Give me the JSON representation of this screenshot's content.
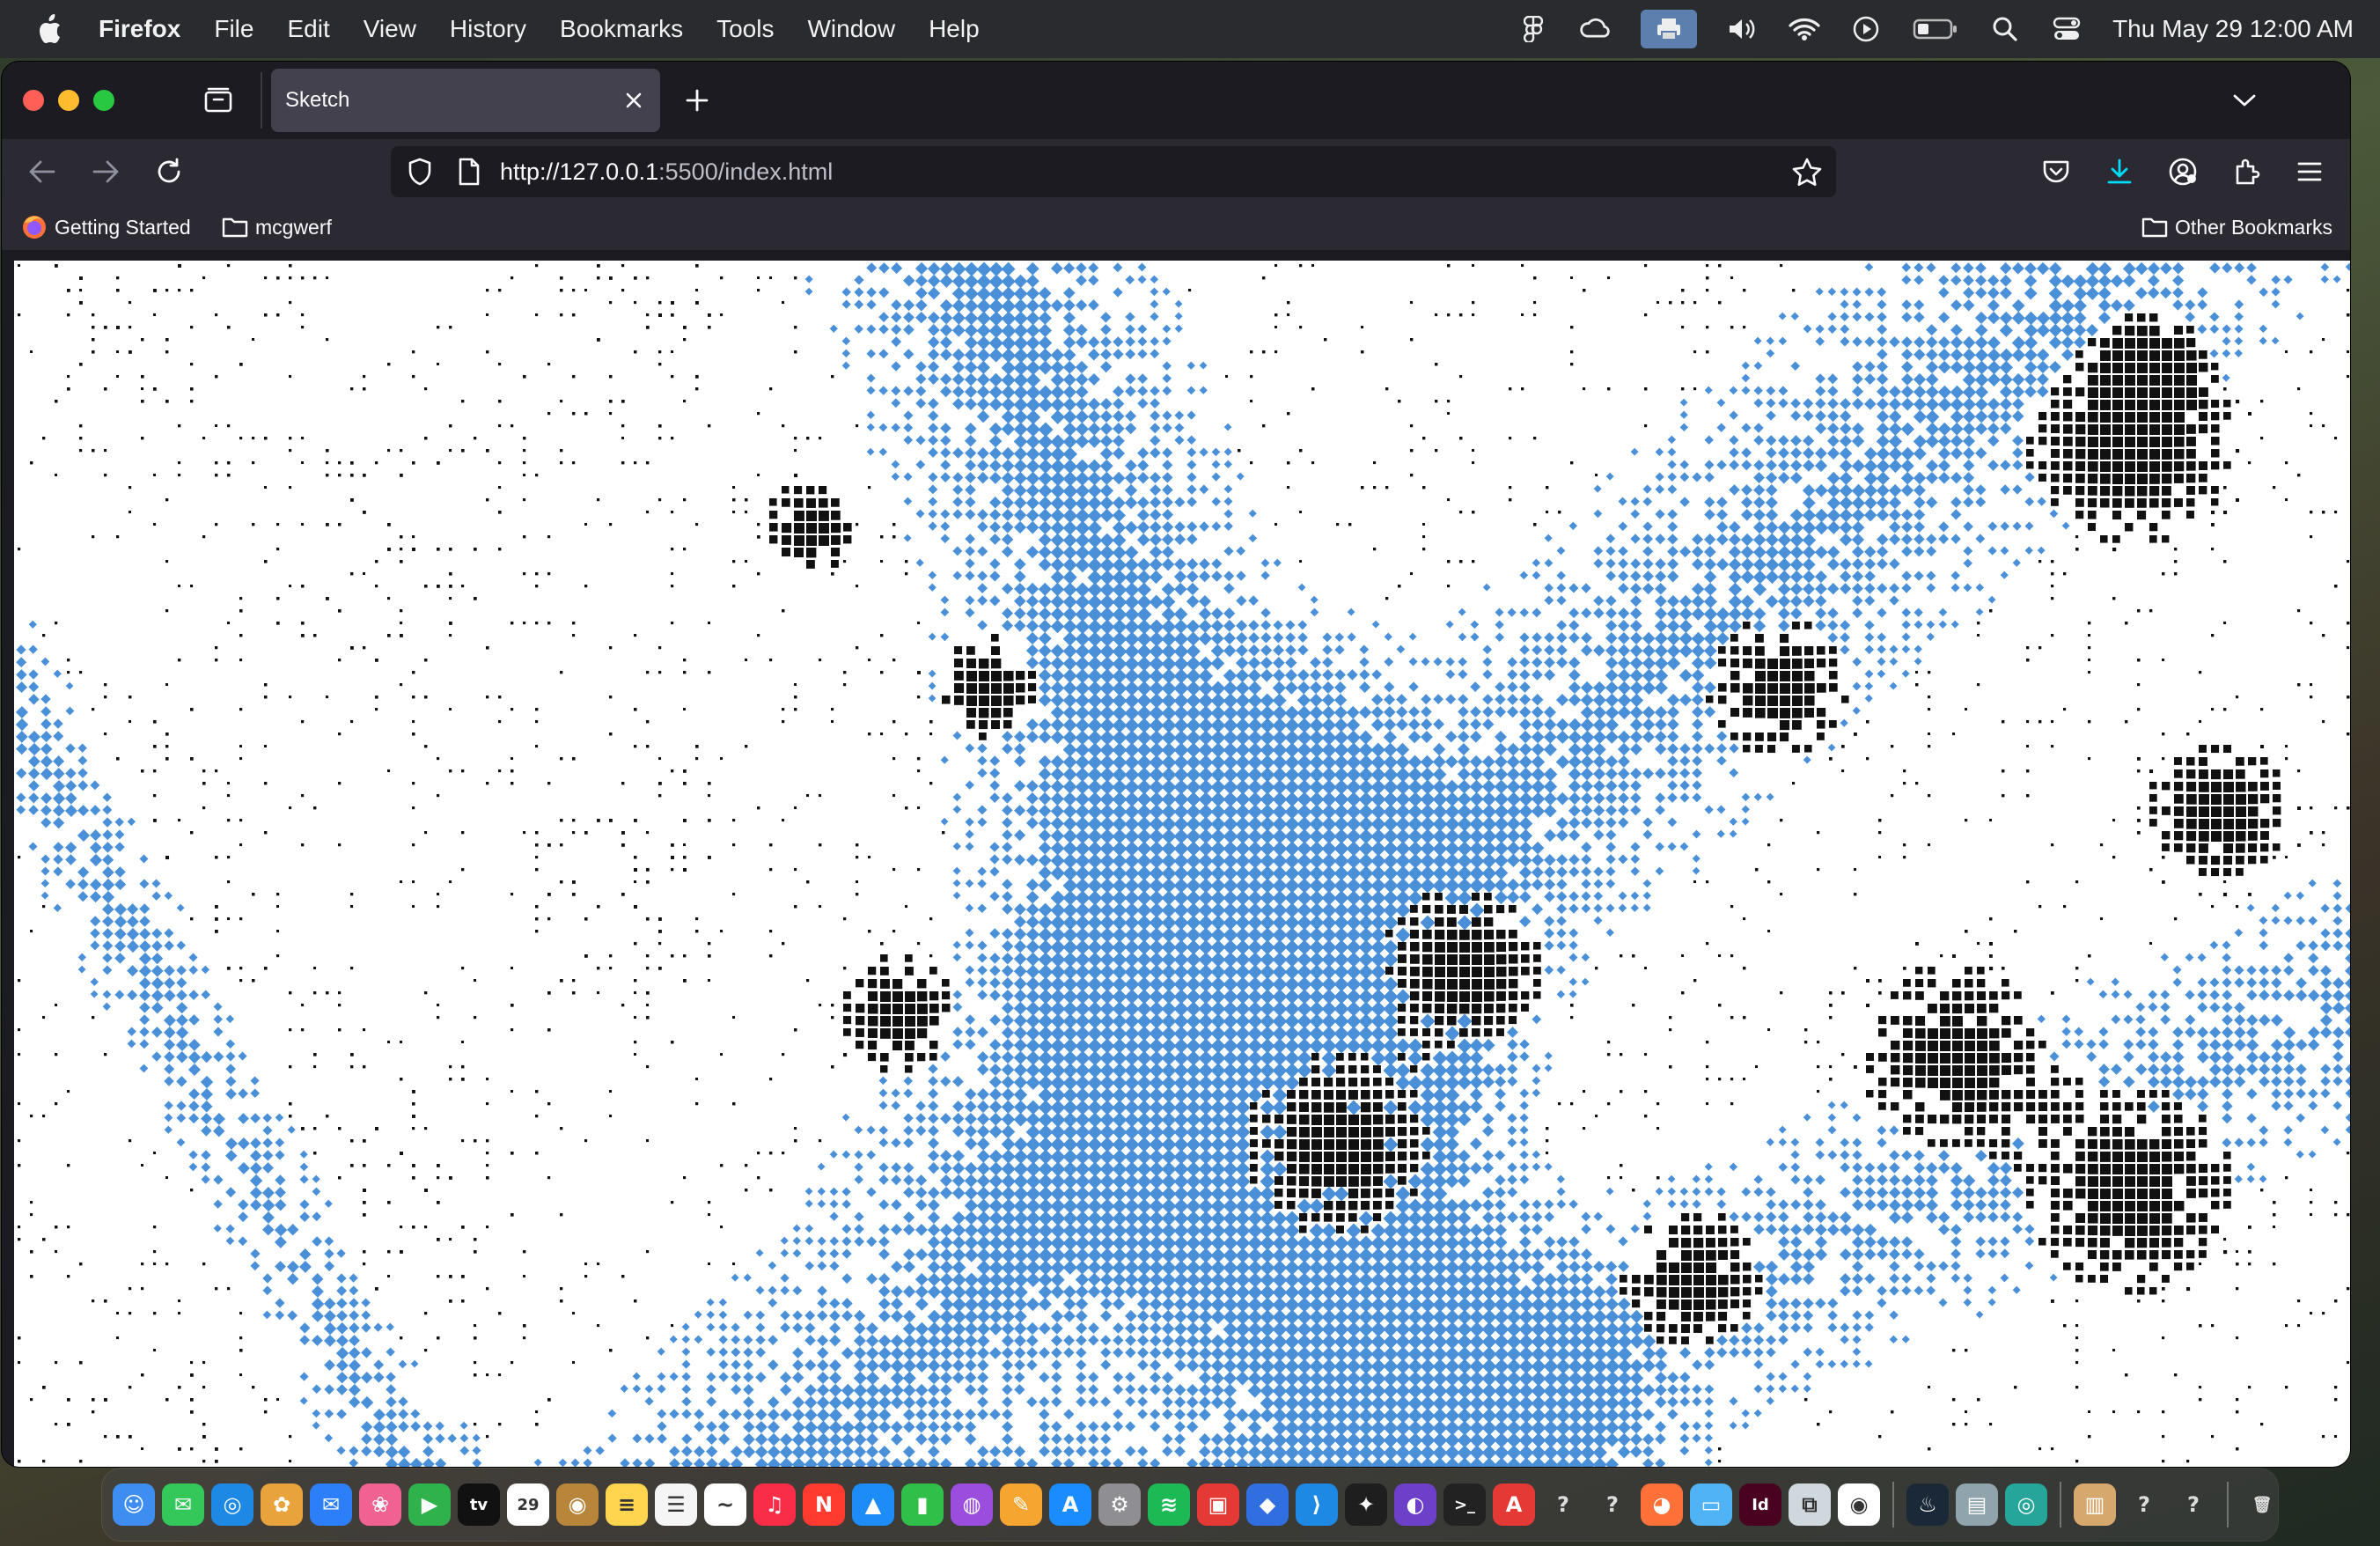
{
  "menubar": {
    "app_name": "Firefox",
    "menus": [
      "File",
      "Edit",
      "View",
      "History",
      "Bookmarks",
      "Tools",
      "Window",
      "Help"
    ],
    "clock": "Thu May 29  12:00 AM",
    "status_icons": [
      "figma-icon",
      "creative-cloud-icon",
      "printer-icon",
      "volume-icon",
      "wifi-icon",
      "play-icon",
      "battery-icon",
      "search-icon",
      "control-center-icon"
    ]
  },
  "browser": {
    "tab_title": "Sketch",
    "url_host": "http://127.0.0.1",
    "url_rest": ":5500/index.html",
    "bookmarks": {
      "getting_started": "Getting Started",
      "folder": "mcgwerf",
      "other": "Other Bookmarks"
    }
  },
  "content": {
    "description_colors": {
      "dot_black": "#111111",
      "dot_blue": "#4a90d9",
      "background": "#ffffff"
    }
  },
  "dock": {
    "apps": [
      {
        "name": "finder",
        "glyph": "☺",
        "color": "#3d8ef0"
      },
      {
        "name": "messages",
        "glyph": "✉",
        "color": "#34c759"
      },
      {
        "name": "safari",
        "glyph": "◎",
        "color": "#1e88e5"
      },
      {
        "name": "photos",
        "glyph": "✿",
        "color": "#e8a33c"
      },
      {
        "name": "mail",
        "glyph": "✉",
        "color": "#2d7ff9"
      },
      {
        "name": "photos-app",
        "glyph": "❀",
        "color": "#f06292"
      },
      {
        "name": "facetime",
        "glyph": "▶",
        "color": "#2fb24c"
      },
      {
        "name": "apple-tv",
        "glyph": "tv",
        "color": "#111111"
      },
      {
        "name": "calendar",
        "glyph": "29",
        "color": "#ffffff"
      },
      {
        "name": "notes-bronze",
        "glyph": "◉",
        "color": "#b8863b"
      },
      {
        "name": "notes",
        "glyph": "≡",
        "color": "#ffd54f"
      },
      {
        "name": "reminders",
        "glyph": "☰",
        "color": "#f5f5f5"
      },
      {
        "name": "freeform",
        "glyph": "~",
        "color": "#ffffff"
      },
      {
        "name": "music",
        "glyph": "♫",
        "color": "#fa2d48"
      },
      {
        "name": "news",
        "glyph": "N",
        "color": "#ff3b30"
      },
      {
        "name": "keynote",
        "glyph": "▲",
        "color": "#1d8cf8"
      },
      {
        "name": "numbers",
        "glyph": "▮",
        "color": "#30c04a"
      },
      {
        "name": "podcasts",
        "glyph": "◍",
        "color": "#9b4dde"
      },
      {
        "name": "pages",
        "glyph": "✎",
        "color": "#f7a531"
      },
      {
        "name": "app-store",
        "glyph": "A",
        "color": "#1a8cff"
      },
      {
        "name": "system-settings",
        "glyph": "⚙",
        "color": "#8e8e93"
      },
      {
        "name": "spotify",
        "glyph": "≋",
        "color": "#1db954"
      },
      {
        "name": "tableplus",
        "glyph": "▣",
        "color": "#e53935"
      },
      {
        "name": "word-app",
        "glyph": "◆",
        "color": "#2f6fe0"
      },
      {
        "name": "vscode",
        "glyph": "⟩",
        "color": "#1e88e5"
      },
      {
        "name": "figma",
        "glyph": "✦",
        "color": "#1e1e1e"
      },
      {
        "name": "github-desktop",
        "glyph": "◐",
        "color": "#6e40c9"
      },
      {
        "name": "terminal",
        "glyph": ">_",
        "color": "#222222"
      },
      {
        "name": "acrobat",
        "glyph": "A",
        "color": "#e53935"
      },
      {
        "name": "unknown-1",
        "glyph": "?",
        "color": "transparent"
      },
      {
        "name": "unknown-2",
        "glyph": "?",
        "color": "transparent"
      },
      {
        "name": "firefox",
        "glyph": "◕",
        "color": "#ff7139"
      },
      {
        "name": "folder",
        "glyph": "▭",
        "color": "#4fb3f6"
      },
      {
        "name": "indesign",
        "glyph": "Id",
        "color": "#49021f"
      },
      {
        "name": "preview",
        "glyph": "⧉",
        "color": "#cfd8dc"
      },
      {
        "name": "chrome",
        "glyph": "◉",
        "color": "#ffffff"
      },
      {
        "name": "steam",
        "glyph": "♨",
        "color": "#1b2838"
      },
      {
        "name": "remote-desktop",
        "glyph": "▤",
        "color": "#90a4ae"
      },
      {
        "name": "screen-share",
        "glyph": "◎",
        "color": "#26a69a"
      },
      {
        "name": "preview-doc",
        "glyph": "▥",
        "color": "#d7a86e"
      },
      {
        "name": "unknown-3",
        "glyph": "?",
        "color": "transparent"
      },
      {
        "name": "unknown-4",
        "glyph": "?",
        "color": "transparent"
      },
      {
        "name": "trash",
        "glyph": "🗑",
        "color": "transparent"
      }
    ]
  }
}
